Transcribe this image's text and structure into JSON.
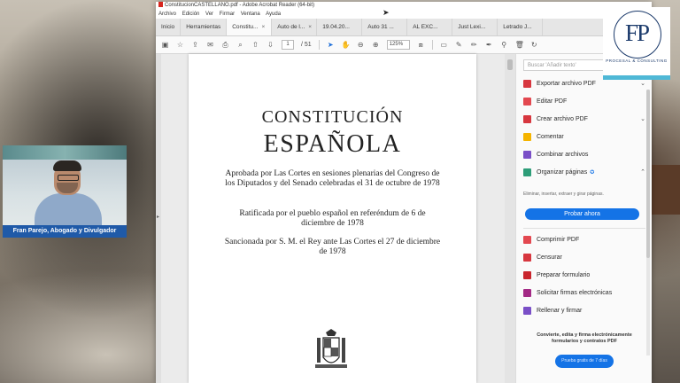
{
  "window": {
    "title": "ConstitucionCASTELLANO.pdf - Adobe Acrobat Reader (64-bit)"
  },
  "menu": [
    "Archivo",
    "Edición",
    "Ver",
    "Firmar",
    "Ventana",
    "Ayuda"
  ],
  "tabs": {
    "home": "Inicio",
    "tools": "Herramientas",
    "docs": [
      {
        "label": "Constitu..."
      },
      {
        "label": "Auto de l..."
      },
      {
        "label": "19.04.20..."
      },
      {
        "label": "Auto 31 ..."
      },
      {
        "label": "AL EXC..."
      },
      {
        "label": "Just Lexi..."
      },
      {
        "label": "Letrado J..."
      }
    ],
    "close": "×"
  },
  "toolbar": {
    "page_current": "1",
    "page_total": "/ 51",
    "zoom": "125%"
  },
  "document": {
    "title_line1": "CONSTITUCIÓN",
    "title_line2": "ESPAÑOLA",
    "para1": "Aprobada por Las Cortes en sesiones plenarias del Congreso de los Diputados y del Senado celebradas el 31 de octubre de 1978",
    "para2": "Ratificada por el pueblo español en referéndum de 6 de diciembre de 1978",
    "para3": "Sancionada por S. M. el Rey ante Las Cortes el 27 de diciembre de 1978"
  },
  "pane": {
    "search_placeholder": "Buscar 'Añadir texto'",
    "tools": [
      {
        "label": "Exportar archivo PDF",
        "color": "#d7373f",
        "chev": "⌄"
      },
      {
        "label": "Editar PDF",
        "color": "#e34850",
        "chev": ""
      },
      {
        "label": "Crear archivo PDF",
        "color": "#d7373f",
        "chev": "⌄"
      },
      {
        "label": "Comentar",
        "color": "#f5b400",
        "chev": ""
      },
      {
        "label": "Combinar archivos",
        "color": "#7a4fc7",
        "chev": ""
      },
      {
        "label": "Organizar páginas",
        "color": "#2d9d78",
        "chev": "⌃"
      }
    ],
    "organize_desc": "Eliminar, insertar, extraer y girar páginas.",
    "try_label": "Probar ahora",
    "tools2": [
      {
        "label": "Comprimir PDF",
        "color": "#e34850"
      },
      {
        "label": "Censurar",
        "color": "#d7373f"
      },
      {
        "label": "Preparar formulario",
        "color": "#c9252d"
      },
      {
        "label": "Solicitar firmas electrónicas",
        "color": "#a32a85"
      },
      {
        "label": "Rellenar y firmar",
        "color": "#7a4fc7"
      }
    ],
    "promo": "Convierte, edita y firma electrónicamente formularios y contratos PDF",
    "promo_button": "Prueba gratis de 7 días"
  },
  "webcam": {
    "caption": "Fran Parejo, Abogado y Divulgador"
  },
  "logo": {
    "letters": "FP",
    "tagline": "PROCESAL & CONSULTING"
  }
}
